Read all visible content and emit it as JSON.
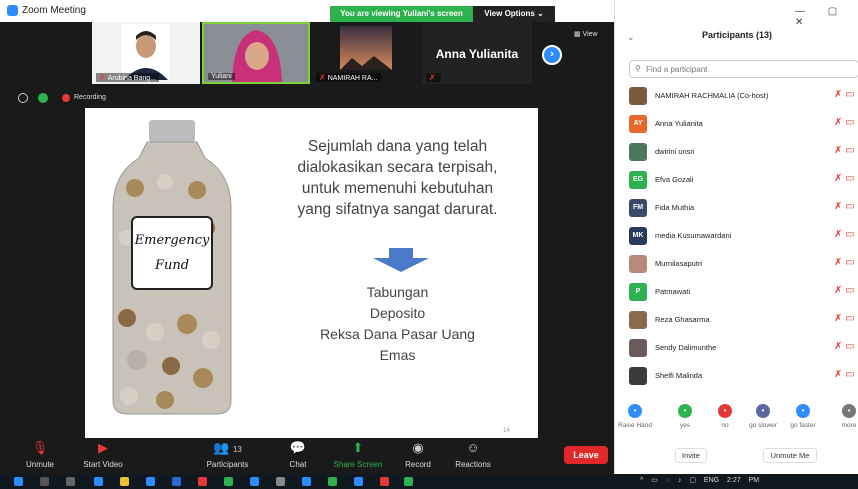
{
  "window": {
    "title": "Zoom Meeting"
  },
  "banner": {
    "viewing": "You are viewing Yuliani's screen",
    "view_options": "View Options ⌄"
  },
  "video_strip": {
    "tiles": [
      {
        "name": "Arubina Bang..."
      },
      {
        "name": "Yuliani"
      },
      {
        "name": "NAMIRAH RA..."
      },
      {
        "name": "Anna Yulianita"
      }
    ],
    "next_icon": "chevron-right-icon",
    "view_label": "View"
  },
  "status_bar": {
    "recording": "Recording"
  },
  "slide": {
    "jar_label_1": "Emergency",
    "jar_label_2": "Fund",
    "text_lines": [
      "Sejumlah dana yang telah",
      "dialokasikan secara terpisah,",
      "untuk  memenuhi kebutuhan",
      "yang sifatnya sangat darurat."
    ],
    "list": [
      "Tabungan",
      "Deposito",
      "Reksa Dana Pasar Uang",
      "Emas"
    ],
    "page_number": "14"
  },
  "toolbar": {
    "unmute": "Unmute",
    "start_video": "Start Video",
    "participants": "Participants",
    "participants_count": "13",
    "chat": "Chat",
    "share_screen": "Share Screen",
    "record": "Record",
    "reactions": "Reactions",
    "leave": "Leave"
  },
  "panel": {
    "title": "Participants (13)",
    "search_placeholder": "Find a participant",
    "participants": [
      {
        "initials": "",
        "name": "NAMIRAH RACHMALIA (Co-host)",
        "color": "#7a5a3a"
      },
      {
        "initials": "AY",
        "name": "Anna Yulianita",
        "color": "#e8682a"
      },
      {
        "initials": "",
        "name": "dwirini unsri",
        "color": "#4a7a5a"
      },
      {
        "initials": "EG",
        "name": "Efva Gozali",
        "color": "#2db24f"
      },
      {
        "initials": "FM",
        "name": "Fida Muthia",
        "color": "#3a4a6a"
      },
      {
        "initials": "MK",
        "name": "media Kusumawardani",
        "color": "#2a3a5a"
      },
      {
        "initials": "",
        "name": "Murnilasaputri",
        "color": "#b88a7a"
      },
      {
        "initials": "P",
        "name": "Patmawati",
        "color": "#2db24f"
      },
      {
        "initials": "",
        "name": "Reza Ghasarma",
        "color": "#8a6a4a"
      },
      {
        "initials": "",
        "name": "Sendy Dalimunthe",
        "color": "#6a5a5a"
      },
      {
        "initials": "",
        "name": "Shelfi Malinda",
        "color": "#3a3a3a"
      }
    ],
    "reactions": [
      {
        "label": "Raise Hand",
        "color": "#2d8cff"
      },
      {
        "label": "yes",
        "color": "#2db24f"
      },
      {
        "label": "no",
        "color": "#e53935"
      },
      {
        "label": "go slower",
        "color": "#5a6aa0"
      },
      {
        "label": "go faster",
        "color": "#2d8cff"
      },
      {
        "label": "more",
        "color": "#777777"
      }
    ],
    "invite": "Invite",
    "unmute_me": "Unmute Me"
  },
  "taskbar": {
    "tray": "ENG",
    "time": "2:27 PM"
  }
}
